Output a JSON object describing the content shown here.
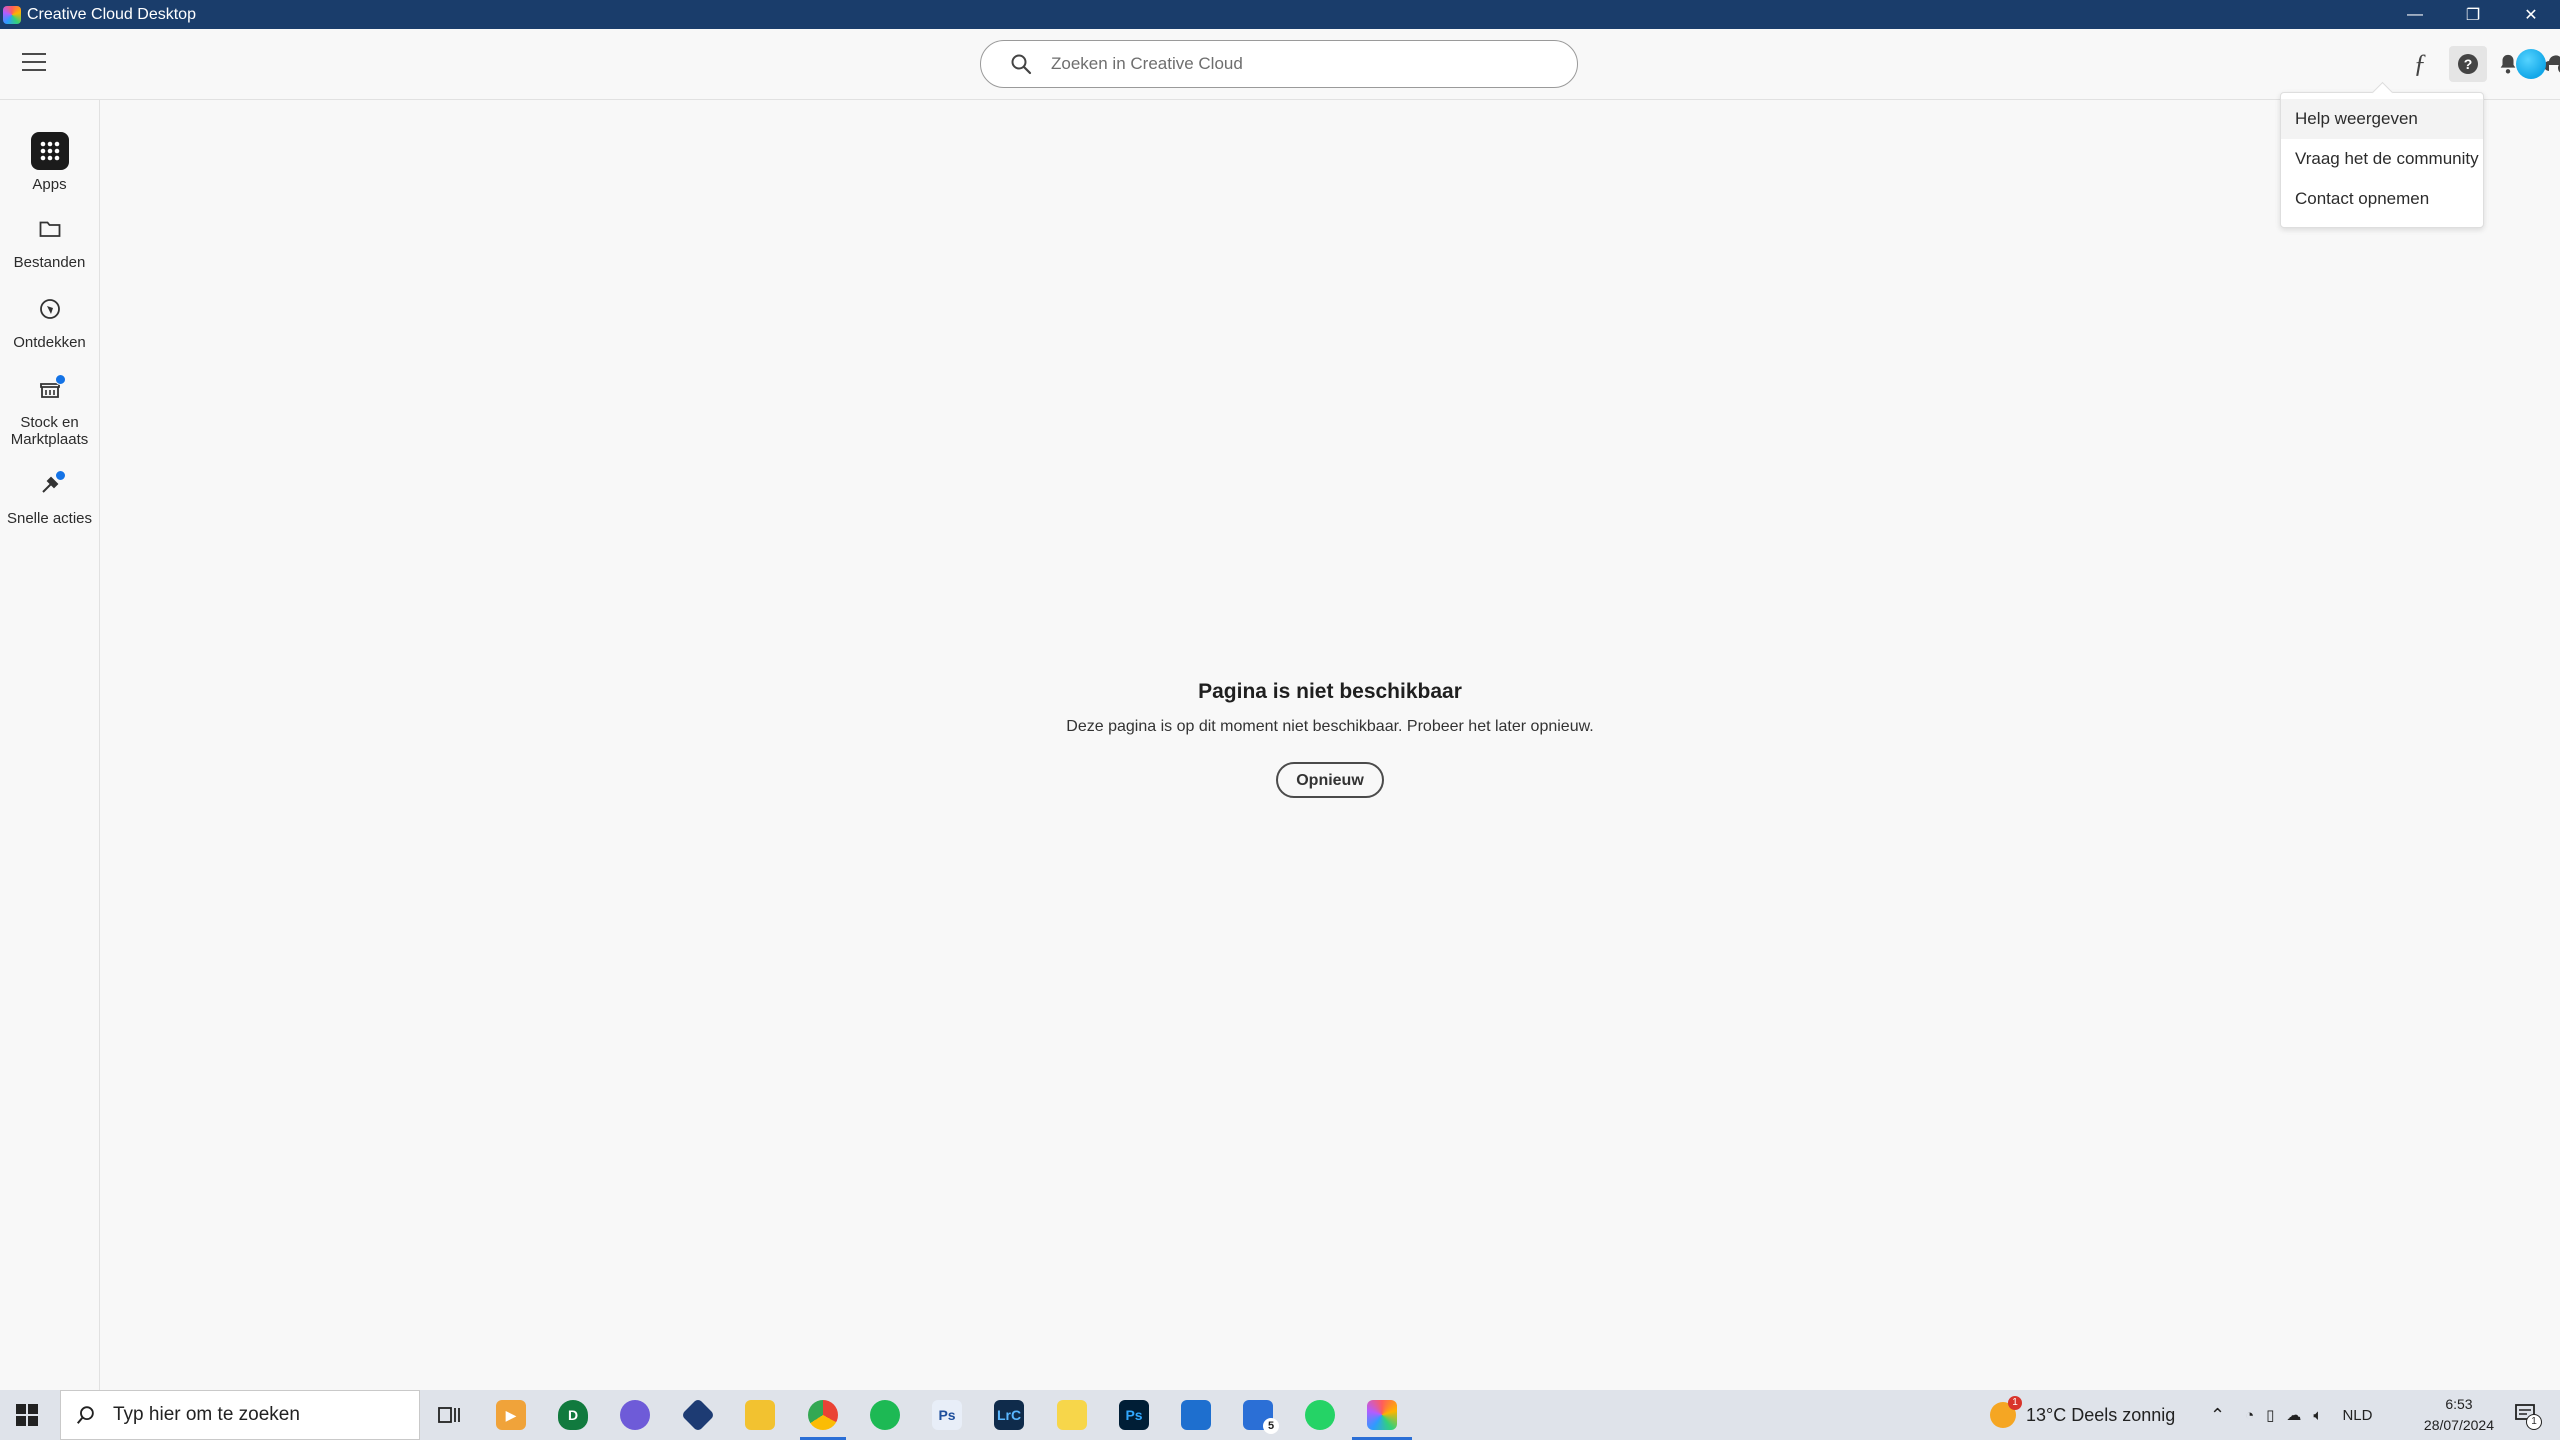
{
  "window": {
    "title": "Creative Cloud Desktop",
    "controls": {
      "minimize": "—",
      "restore": "❐",
      "close": "✕"
    }
  },
  "header": {
    "search_placeholder": "Zoeken in Creative Cloud",
    "icons": [
      "hamburger-menu-icon",
      "search-icon",
      "fonts-icon",
      "help-icon",
      "bell-icon",
      "cloud-sync-icon",
      "avatar"
    ]
  },
  "help_menu": {
    "items": [
      {
        "label": "Help weergeven"
      },
      {
        "label": "Vraag het de community"
      },
      {
        "label": "Contact opnemen"
      }
    ]
  },
  "sidebar": {
    "items": [
      {
        "label": "Apps",
        "icon": "apps-grid-icon"
      },
      {
        "label": "Bestanden",
        "icon": "folder-icon"
      },
      {
        "label": "Ontdekken",
        "icon": "compass-icon"
      },
      {
        "label": "Stock en Marktplaats",
        "icon": "stock-icon"
      },
      {
        "label": "Snelle acties",
        "icon": "quick-actions-icon"
      }
    ]
  },
  "main": {
    "title": "Pagina is niet beschikbaar",
    "message": "Deze pagina is op dit moment niet beschikbaar. Probeer het later opnieuw.",
    "retry_label": "Opnieuw"
  },
  "taskbar": {
    "search_placeholder": "Typ hier om te zoeken",
    "apps": [
      {
        "name": "Lr",
        "label": "LrC"
      },
      {
        "name": "Ps1",
        "label": "Ps"
      },
      {
        "name": "Ps2",
        "label": "Ps"
      }
    ],
    "mail_badge": "5",
    "weather": "13°C Deels zonnig",
    "weather_badge": "1",
    "language": "NLD",
    "time": "6:53",
    "date": "28/07/2024",
    "notification_count": "1"
  },
  "colors": {
    "titlebar": "#1a3d6b",
    "accent_blue": "#1473e6",
    "avatar": "#12a7e8"
  }
}
